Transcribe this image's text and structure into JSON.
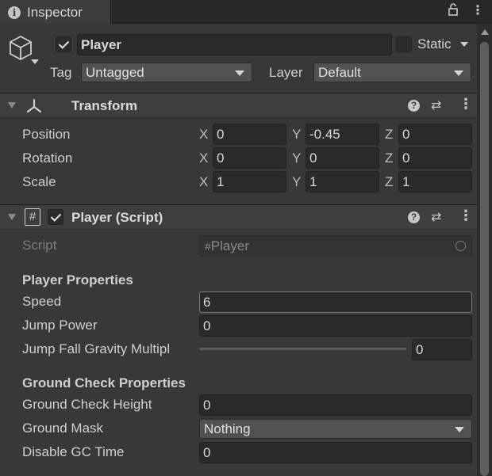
{
  "tab": {
    "title": "Inspector"
  },
  "object": {
    "name": "Player",
    "active": true,
    "static_label": "Static",
    "static_checked": false,
    "tag_label": "Tag",
    "tag_value": "Untagged",
    "layer_label": "Layer",
    "layer_value": "Default"
  },
  "transform": {
    "title": "Transform",
    "rows": [
      {
        "label": "Position",
        "x": "0",
        "y": "-0.45",
        "z": "0"
      },
      {
        "label": "Rotation",
        "x": "0",
        "y": "0",
        "z": "0"
      },
      {
        "label": "Scale",
        "x": "1",
        "y": "1",
        "z": "1"
      }
    ],
    "axis": {
      "x": "X",
      "y": "Y",
      "z": "Z"
    }
  },
  "player_script": {
    "title": "Player (Script)",
    "enabled": true,
    "script_label": "Script",
    "script_value": "Player",
    "player_section": "Player Properties",
    "speed_label": "Speed",
    "speed_value": "6",
    "jump_power_label": "Jump Power",
    "jump_power_value": "0",
    "jump_fall_label": "Jump Fall Gravity Multipl",
    "jump_fall_value": "0",
    "ground_section": "Ground Check Properties",
    "ground_height_label": "Ground Check Height",
    "ground_height_value": "0",
    "ground_mask_label": "Ground Mask",
    "ground_mask_value": "Nothing",
    "disable_gc_label": "Disable GC Time",
    "disable_gc_value": "0"
  },
  "icons": {
    "tab": "info-icon",
    "lock": "lock-icon",
    "menu": "kebab-menu-icon",
    "object": "cube-icon",
    "transform": "transform-axes-icon",
    "script": "hash-script-icon",
    "help": "help-icon",
    "presets": "presets-icon"
  }
}
